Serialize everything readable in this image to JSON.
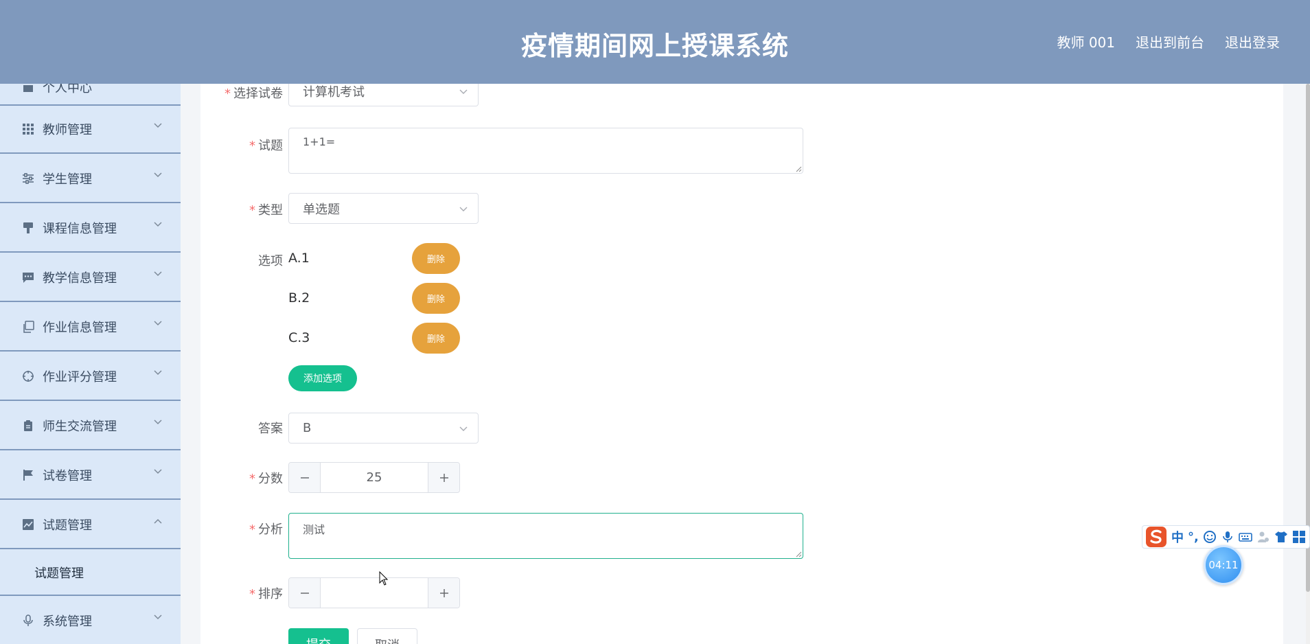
{
  "header": {
    "title": "疫情期间网上授课系统",
    "links": [
      "教师 001",
      "退出到前台",
      "退出登录"
    ]
  },
  "sidebar": {
    "partial_top_label": "个人中心",
    "items": [
      {
        "label": "教师管理",
        "icon": "grid-icon"
      },
      {
        "label": "学生管理",
        "icon": "sliders-icon"
      },
      {
        "label": "课程信息管理",
        "icon": "brush-icon"
      },
      {
        "label": "教学信息管理",
        "icon": "chat-icon"
      },
      {
        "label": "作业信息管理",
        "icon": "copy-icon"
      },
      {
        "label": "作业评分管理",
        "icon": "crosshair-icon"
      },
      {
        "label": "师生交流管理",
        "icon": "clipboard-icon"
      },
      {
        "label": "试卷管理",
        "icon": "flag-icon"
      },
      {
        "label": "试题管理",
        "icon": "chart-icon",
        "expanded": true
      },
      {
        "label": "系统管理",
        "icon": "mic-icon"
      }
    ],
    "sub_item": "试题管理"
  },
  "form": {
    "paper": {
      "label": "选择试卷",
      "value": "计算机考试"
    },
    "question": {
      "label": "试题",
      "value": "1+1="
    },
    "type": {
      "label": "类型",
      "value": "单选题"
    },
    "options": {
      "label": "选项",
      "items": [
        "A.1",
        "B.2",
        "C.3"
      ],
      "delete_label": "删除",
      "add_label": "添加选项"
    },
    "answer": {
      "label": "答案",
      "value": "B"
    },
    "score": {
      "label": "分数",
      "value": "25"
    },
    "analysis": {
      "label": "分析",
      "value": "测试"
    },
    "order": {
      "label": "排序",
      "value": ""
    },
    "submit_label": "提交",
    "cancel_label": "取消"
  },
  "ime": {
    "lang": "中",
    "punct": "°,"
  },
  "timer": "04:11"
}
